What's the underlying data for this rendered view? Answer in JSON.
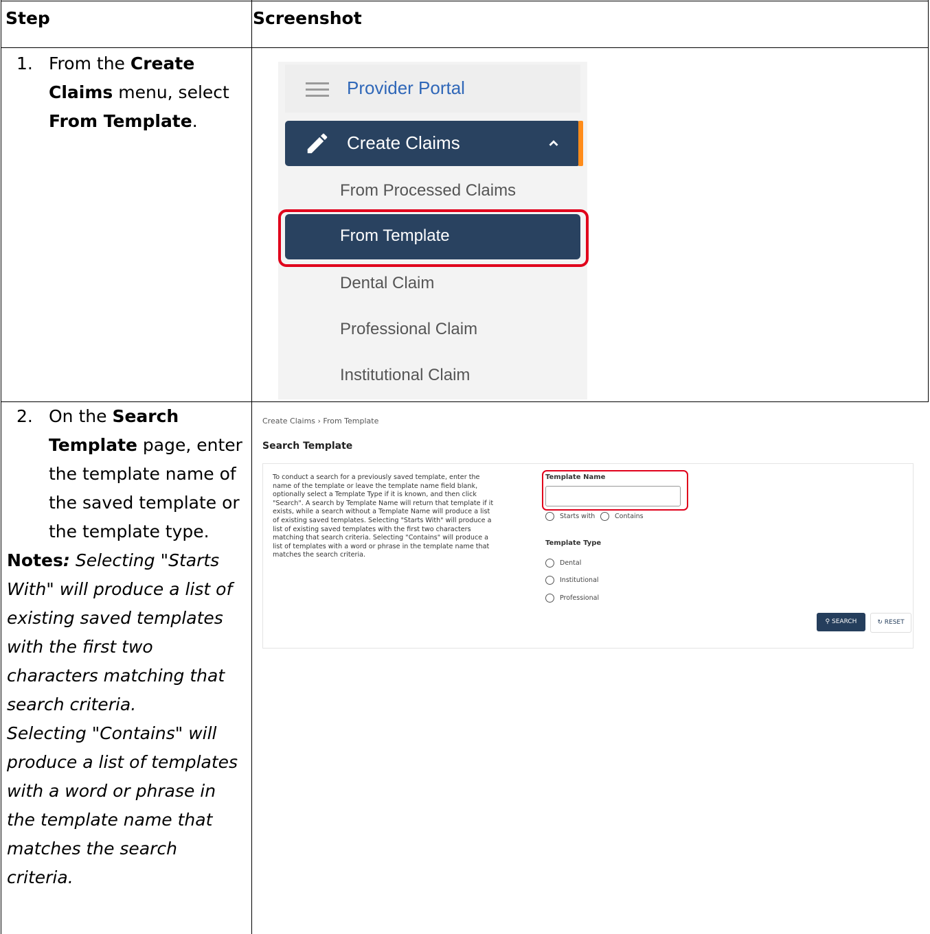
{
  "table": {
    "header": {
      "step": "Step",
      "screenshot": "Screenshot"
    },
    "step1": {
      "number": "1.",
      "text_a": "From the ",
      "bold_a": "Create",
      "bold_b": "Claims",
      "text_b": " menu, select",
      "bold_c": "From Template",
      "text_c": "."
    },
    "step2": {
      "number": "2.",
      "text_a": "On the ",
      "bold_a": "Search",
      "bold_b": "Template",
      "text_b": " page, enter",
      "line3": "the template name of",
      "line4": "the saved template or",
      "line5": "the template type.",
      "notes_label": "Notes",
      "notes_colon": ":",
      "note1_lines": [
        "Selecting \"Starts",
        "With\" will produce a list of",
        "existing saved templates",
        "with the first two",
        "characters matching that",
        "search criteria."
      ],
      "note2_lines": [
        "Selecting \"Contains\" will",
        "produce a list of templates",
        "with a word or phrase in",
        "the template name that",
        "matches the search",
        "criteria."
      ]
    }
  },
  "menu": {
    "portal_title": "Provider Portal",
    "create_claims": "Create Claims",
    "items": [
      "From Processed Claims",
      "From Template",
      "Dental Claim",
      "Professional Claim",
      "Institutional Claim"
    ]
  },
  "search_page": {
    "breadcrumb": "Create Claims  ›  From Template",
    "title": "Search Template",
    "description_lines": [
      "To conduct a search for a previously saved template, enter the",
      "name of the template or leave the template name field blank,",
      "optionally select a Template Type if it is known, and then click",
      "\"Search\". A search by Template Name will return that template if it",
      "exists, while a search without a Template Name will produce a list",
      "of existing saved templates. Selecting \"Starts With\" will produce a",
      "list of existing saved templates with the first two characters",
      "matching that search criteria. Selecting \"Contains\" will produce a",
      "list of templates with a word or phrase in the template name that",
      "matches the search criteria."
    ],
    "template_name_label": "Template Name",
    "template_name_value": "",
    "match_options": [
      "Starts with",
      "Contains"
    ],
    "template_type_label": "Template Type",
    "template_types": [
      "Dental",
      "Institutional",
      "Professional"
    ],
    "search_button": "SEARCH",
    "reset_button": "RESET"
  },
  "colors": {
    "navy": "#294260",
    "accent_orange": "#ff8c1a",
    "highlight_red": "#e0001b",
    "link_blue": "#2f67b8"
  }
}
